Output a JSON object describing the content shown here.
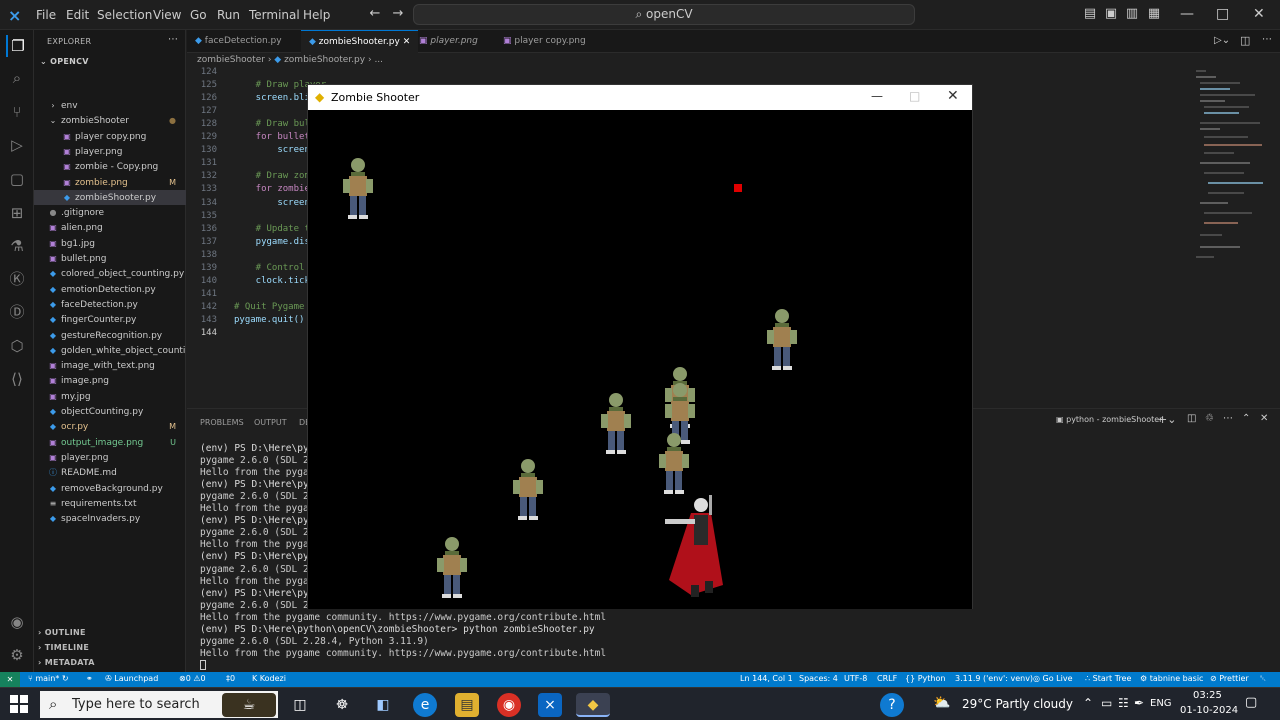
{
  "titlebar": {
    "menus": [
      "File",
      "Edit",
      "Selection",
      "View",
      "Go",
      "Run",
      "Terminal",
      "Help"
    ],
    "search": "openCV"
  },
  "explorer": {
    "title": "EXPLORER",
    "root": "OPENCV",
    "items": [
      {
        "label": "env",
        "badge": ""
      },
      {
        "label": "zombieShooter",
        "badge": ""
      },
      {
        "label": "player copy.png",
        "badge": ""
      },
      {
        "label": "player.png",
        "badge": ""
      },
      {
        "label": "zombie - Copy.png",
        "badge": ""
      },
      {
        "label": "zombie.png",
        "badge": "M"
      },
      {
        "label": "zombieShooter.py",
        "badge": ""
      },
      {
        "label": ".gitignore",
        "badge": ""
      },
      {
        "label": "alien.png",
        "badge": ""
      },
      {
        "label": "bg1.jpg",
        "badge": ""
      },
      {
        "label": "bullet.png",
        "badge": ""
      },
      {
        "label": "colored_object_counting.py",
        "badge": ""
      },
      {
        "label": "emotionDetection.py",
        "badge": ""
      },
      {
        "label": "faceDetection.py",
        "badge": ""
      },
      {
        "label": "fingerCounter.py",
        "badge": ""
      },
      {
        "label": "gestureRecognition.py",
        "badge": ""
      },
      {
        "label": "golden_white_object_counting...",
        "badge": ""
      },
      {
        "label": "image_with_text.png",
        "badge": ""
      },
      {
        "label": "image.png",
        "badge": ""
      },
      {
        "label": "my.jpg",
        "badge": ""
      },
      {
        "label": "objectCounting.py",
        "badge": ""
      },
      {
        "label": "ocr.py",
        "badge": "M"
      },
      {
        "label": "output_image.png",
        "badge": "U"
      },
      {
        "label": "player.png",
        "badge": ""
      },
      {
        "label": "README.md",
        "badge": ""
      },
      {
        "label": "removeBackground.py",
        "badge": ""
      },
      {
        "label": "requirements.txt",
        "badge": ""
      },
      {
        "label": "spaceInvaders.py",
        "badge": ""
      }
    ],
    "sections": [
      "OUTLINE",
      "TIMELINE",
      "METADATA"
    ]
  },
  "tabs": [
    {
      "label": "faceDetection.py"
    },
    {
      "label": "zombieShooter.py"
    },
    {
      "label": "player.png"
    },
    {
      "label": "player copy.png"
    }
  ],
  "breadcrumb": {
    "folder": "zombieShooter",
    "file": "zombieShooter.py",
    "more": "..."
  },
  "code": [
    {
      "ln": "124",
      "text": ""
    },
    {
      "ln": "125",
      "text": "    # Draw player"
    },
    {
      "ln": "126",
      "text": "    screen.bli"
    },
    {
      "ln": "127",
      "text": ""
    },
    {
      "ln": "128",
      "text": "    # Draw bul"
    },
    {
      "ln": "129",
      "text": "    for bullet"
    },
    {
      "ln": "130",
      "text": "        screen"
    },
    {
      "ln": "131",
      "text": ""
    },
    {
      "ln": "132",
      "text": "    # Draw zom"
    },
    {
      "ln": "133",
      "text": "    for zombie"
    },
    {
      "ln": "134",
      "text": "        screen"
    },
    {
      "ln": "135",
      "text": ""
    },
    {
      "ln": "136",
      "text": "    # Update t"
    },
    {
      "ln": "137",
      "text": "    pygame.dis"
    },
    {
      "ln": "138",
      "text": ""
    },
    {
      "ln": "139",
      "text": "    # Control"
    },
    {
      "ln": "140",
      "text": "    clock.tick"
    },
    {
      "ln": "141",
      "text": ""
    },
    {
      "ln": "142",
      "text": "# Quit Pygame"
    },
    {
      "ln": "143",
      "text": "pygame.quit()"
    },
    {
      "ln": "144",
      "text": ""
    }
  ],
  "panel": {
    "tabs": [
      "PROBLEMS",
      "OUTPUT",
      "DE"
    ],
    "terminal_name": "python - zombieShooter",
    "lines": [
      "(env) PS D:\\Here\\pyt",
      "pygame 2.6.0 (SDL 2.",
      "Hello from the pygam",
      "(env) PS D:\\Here\\pyt",
      "pygame 2.6.0 (SDL 2.",
      "Hello from the pygam",
      "(env) PS D:\\Here\\pyt",
      "pygame 2.6.0 (SDL 2.",
      "Hello from the pygam",
      "(env) PS D:\\Here\\pyt",
      "pygame 2.6.0 (SDL 2.",
      "Hello from the pygam",
      "(env) PS D:\\Here\\pyt",
      "pygame 2.6.0 (SDL 2.",
      "Hello from the pygame community. https://www.pygame.org/contribute.html",
      "(env) PS D:\\Here\\python\\openCV\\zombieShooter> python zombieShooter.py",
      "pygame 2.6.0 (SDL 2.28.4, Python 3.11.9)",
      "Hello from the pygame community. https://www.pygame.org/contribute.html"
    ]
  },
  "game": {
    "title": "Zombie Shooter"
  },
  "statusbar": {
    "branch": "main*",
    "launchpad": "Launchpad",
    "errors": "0",
    "warnings": "0",
    "ports": "0",
    "kodezi": "Kodezi",
    "position": "Ln 144, Col 1",
    "spaces": "Spaces: 4",
    "encoding": "UTF-8",
    "eol": "CRLF",
    "language": "Python",
    "interpreter": "3.11.9 ('env': venv)",
    "golive": "Go Live",
    "starttree": "Start Tree",
    "tabnine": "tabnine basic",
    "prettier": "Prettier"
  },
  "taskbar": {
    "search": "Type here to search",
    "weather": "29°C  Partly cloudy",
    "lang": "ENG",
    "time": "03:25",
    "date": "01-10-2024"
  }
}
